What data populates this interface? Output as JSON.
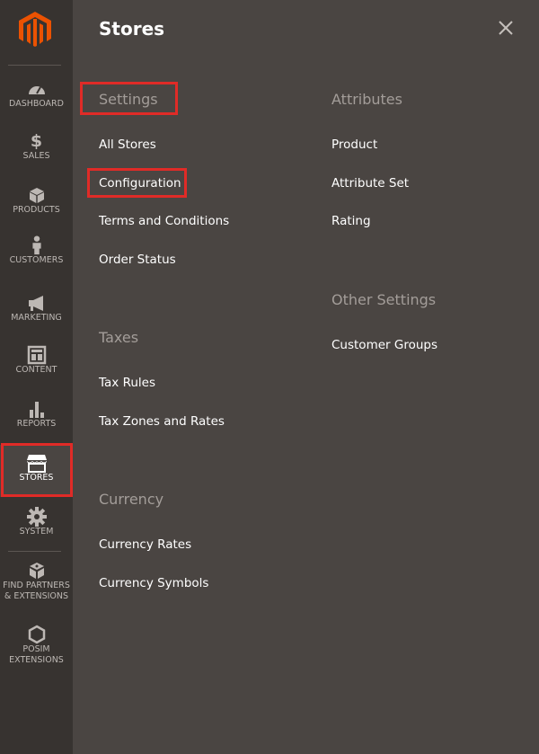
{
  "sidebar": {
    "logo": "magento-logo",
    "items": [
      {
        "label": "DASHBOARD",
        "icon": "dashboard-icon"
      },
      {
        "label": "SALES",
        "icon": "dollar-icon"
      },
      {
        "label": "PRODUCTS",
        "icon": "cube-icon"
      },
      {
        "label": "CUSTOMERS",
        "icon": "person-icon"
      },
      {
        "label": "MARKETING",
        "icon": "megaphone-icon"
      },
      {
        "label": "CONTENT",
        "icon": "layout-icon"
      },
      {
        "label": "REPORTS",
        "icon": "bar-chart-icon"
      },
      {
        "label": "STORES",
        "icon": "storefront-icon",
        "active": true
      },
      {
        "label": "SYSTEM",
        "icon": "gear-icon"
      },
      {
        "label": "FIND PARTNERS & EXTENSIONS",
        "label_line1": "FIND PARTNERS",
        "label_line2": "& EXTENSIONS",
        "icon": "blocks-icon"
      },
      {
        "label": "POSIM EXTENSIONS",
        "label_line1": "POSIM",
        "label_line2": "EXTENSIONS",
        "icon": "hexagon-icon"
      }
    ]
  },
  "panel": {
    "title": "Stores",
    "close_icon": "close-icon"
  },
  "sections": {
    "settings": {
      "title": "Settings",
      "links": [
        "All Stores",
        "Configuration",
        "Terms and Conditions",
        "Order Status"
      ]
    },
    "taxes": {
      "title": "Taxes",
      "links": [
        "Tax Rules",
        "Tax Zones and Rates"
      ]
    },
    "currency": {
      "title": "Currency",
      "links": [
        "Currency Rates",
        "Currency Symbols"
      ]
    },
    "attributes": {
      "title": "Attributes",
      "links": [
        "Product",
        "Attribute Set",
        "Rating"
      ]
    },
    "other_settings": {
      "title": "Other Settings",
      "links": [
        "Customer Groups"
      ]
    }
  },
  "colors": {
    "sidebar_bg": "#373330",
    "panel_bg": "#4a4542",
    "highlight": "#e02b27",
    "logo_orange": "#eb5202",
    "section_title": "#a39d99"
  }
}
